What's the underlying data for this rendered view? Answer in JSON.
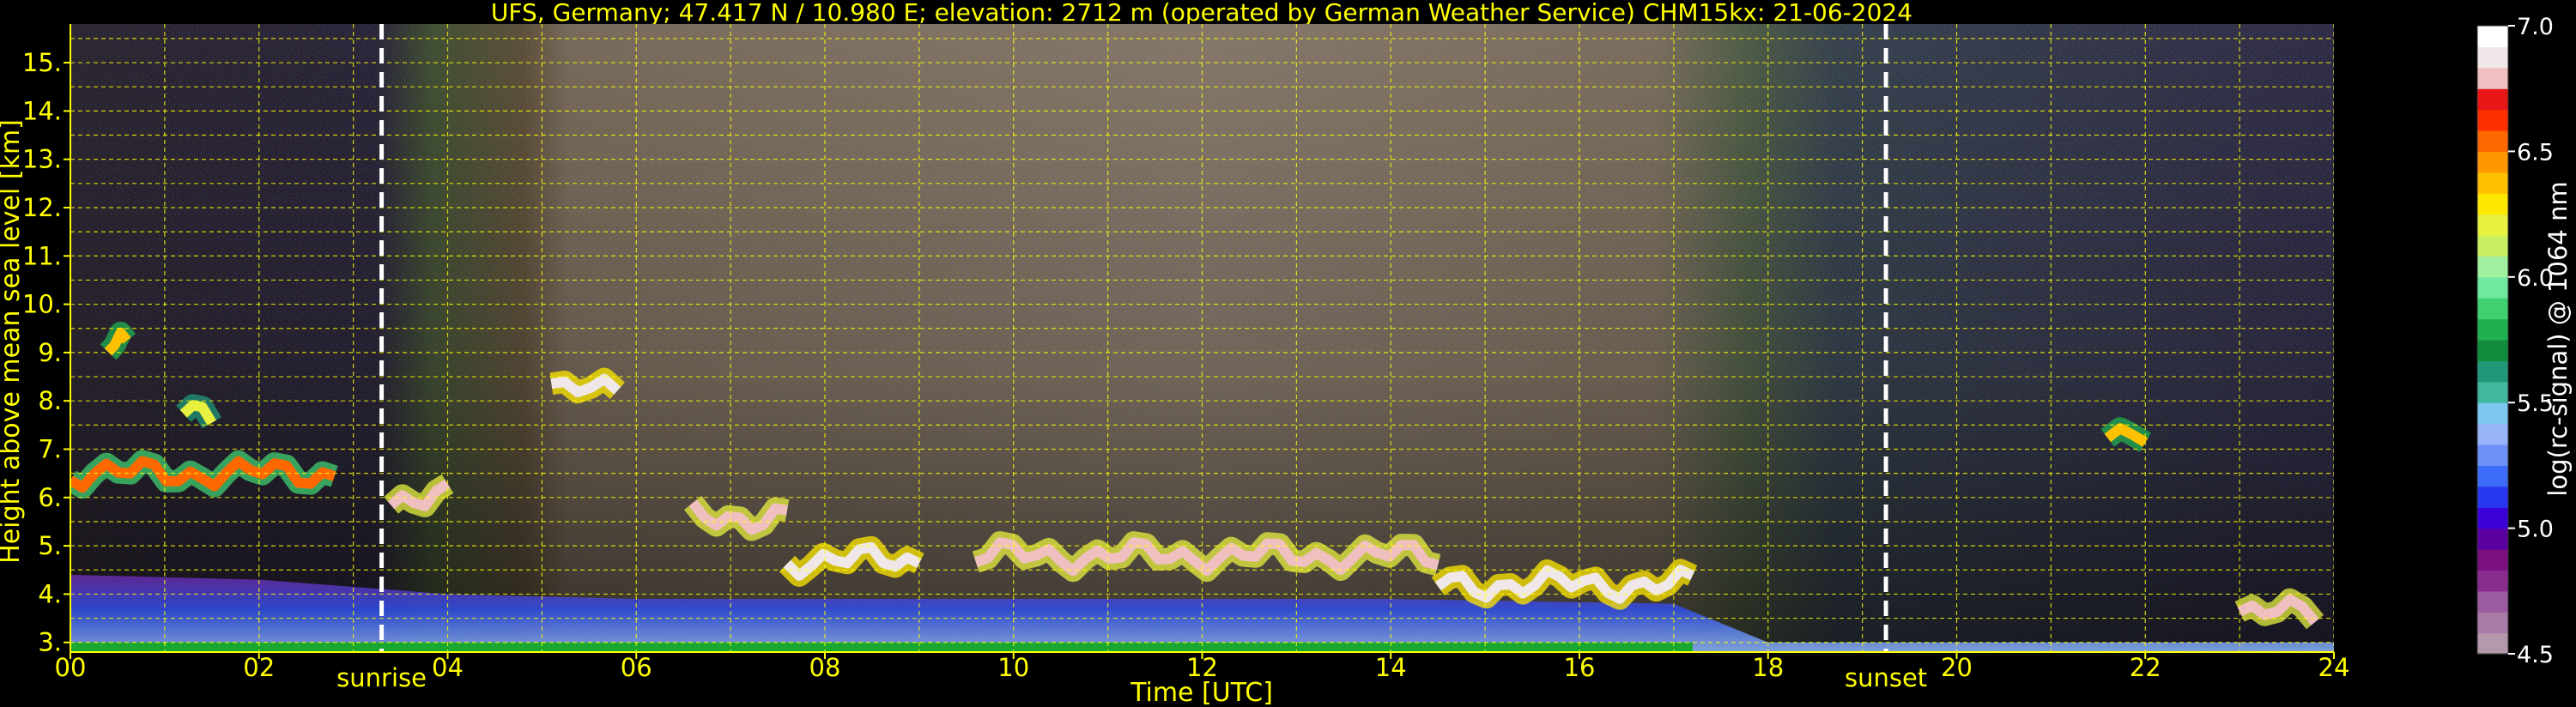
{
  "chart_data": {
    "type": "heatmap",
    "title": "UFS, Germany; 47.417 N / 10.980 E; elevation: 2712 m  (operated by German Weather Service)    CHM15kx: 21-06-2024",
    "xlabel": "Time [UTC]",
    "ylabel": "Height above mean sea level [km]",
    "xlim": [
      0,
      24
    ],
    "ylim": [
      2.8,
      15.8
    ],
    "x_ticks": [
      "00",
      "02",
      "04",
      "06",
      "08",
      "10",
      "12",
      "14",
      "16",
      "18",
      "20",
      "22",
      "24"
    ],
    "y_ticks": [
      "3.",
      "4.",
      "5.",
      "6.",
      "7.",
      "8.",
      "9.",
      "10.",
      "11.",
      "12.",
      "13.",
      "14.",
      "15."
    ],
    "grid": true,
    "grid_color": "#ffff00",
    "colorbar": {
      "label": "log(rc-signal) @ 1064 nm",
      "range": [
        4.5,
        7.0
      ],
      "ticks": [
        "4.5",
        "5.0",
        "5.5",
        "6.0",
        "6.5",
        "7.0"
      ],
      "colors": [
        "#b498ac",
        "#a87aa8",
        "#9c5aa0",
        "#8a2c8e",
        "#7a1080",
        "#5a00a0",
        "#3c00d8",
        "#2838f0",
        "#3c6cf8",
        "#6c90f8",
        "#98b4f8",
        "#7cc8f0",
        "#40b8a0",
        "#209878",
        "#108c3c",
        "#20b050",
        "#40d070",
        "#70e8a0",
        "#a0f0a0",
        "#c8f060",
        "#e8f040",
        "#ffe800",
        "#ffc000",
        "#ff9800",
        "#ff6800",
        "#ff3000",
        "#e81818",
        "#f0c0c0",
        "#f0e8e8",
        "#ffffff"
      ]
    },
    "events": [
      {
        "label": "sunrise",
        "time": 3.3
      },
      {
        "label": "sunset",
        "time": 19.25
      }
    ],
    "cloud_layers": [
      {
        "t0": 0.0,
        "t1": 2.8,
        "height": 6.5,
        "intensity": 6.5
      },
      {
        "t0": 0.4,
        "t1": 0.6,
        "height": 9.1,
        "intensity": 6.4
      },
      {
        "t0": 1.2,
        "t1": 1.5,
        "height": 7.8,
        "intensity": 6.2
      },
      {
        "t0": 3.4,
        "t1": 4.0,
        "height": 6.0,
        "intensity": 6.8
      },
      {
        "t0": 5.1,
        "t1": 5.8,
        "height": 8.2,
        "intensity": 6.9
      },
      {
        "t0": 6.6,
        "t1": 7.6,
        "height": 5.6,
        "intensity": 6.8
      },
      {
        "t0": 7.6,
        "t1": 9.0,
        "height": 4.7,
        "intensity": 6.9
      },
      {
        "t0": 9.6,
        "t1": 14.5,
        "height": 4.8,
        "intensity": 6.8
      },
      {
        "t0": 14.5,
        "t1": 17.2,
        "height": 4.2,
        "intensity": 6.9
      },
      {
        "t0": 21.6,
        "t1": 22.0,
        "height": 7.4,
        "intensity": 6.4
      },
      {
        "t0": 23.0,
        "t1": 23.8,
        "height": 3.6,
        "intensity": 6.8
      }
    ],
    "boundary_layer_top": [
      {
        "t": 0,
        "h": 4.4
      },
      {
        "t": 2,
        "h": 4.3
      },
      {
        "t": 4,
        "h": 4.0
      },
      {
        "t": 6,
        "h": 3.9
      },
      {
        "t": 10,
        "h": 3.9
      },
      {
        "t": 14,
        "h": 3.9
      },
      {
        "t": 17,
        "h": 3.8
      },
      {
        "t": 18,
        "h": 3.0
      },
      {
        "t": 24,
        "h": 3.0
      }
    ]
  }
}
